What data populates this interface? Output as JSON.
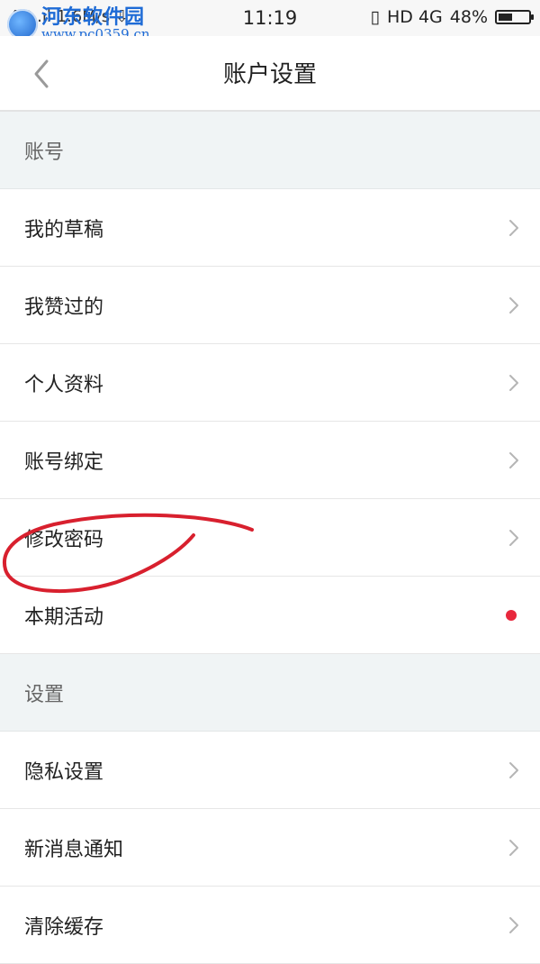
{
  "status_bar": {
    "left_text": "4G .ıl 1.6M/s ⇩",
    "time": "11:19",
    "network": "HD 4G",
    "battery": "48%",
    "battery_level": 0.48
  },
  "watermark": {
    "name": "河东软件园",
    "url": "www.pc0359.cn"
  },
  "navbar": {
    "title": "账户设置"
  },
  "sections": [
    {
      "header": "账号",
      "items": [
        "我的草稿",
        "我赞过的",
        "个人资料",
        "账号绑定",
        "修改密码",
        "本期活动"
      ]
    },
    {
      "header": "设置",
      "items": [
        "隐私设置",
        "新消息通知",
        "清除缓存"
      ]
    }
  ],
  "colors": {
    "section_bg": "#f0f4f5",
    "notification_dot": "#e8283d",
    "annotation_stroke": "#d8202e"
  }
}
